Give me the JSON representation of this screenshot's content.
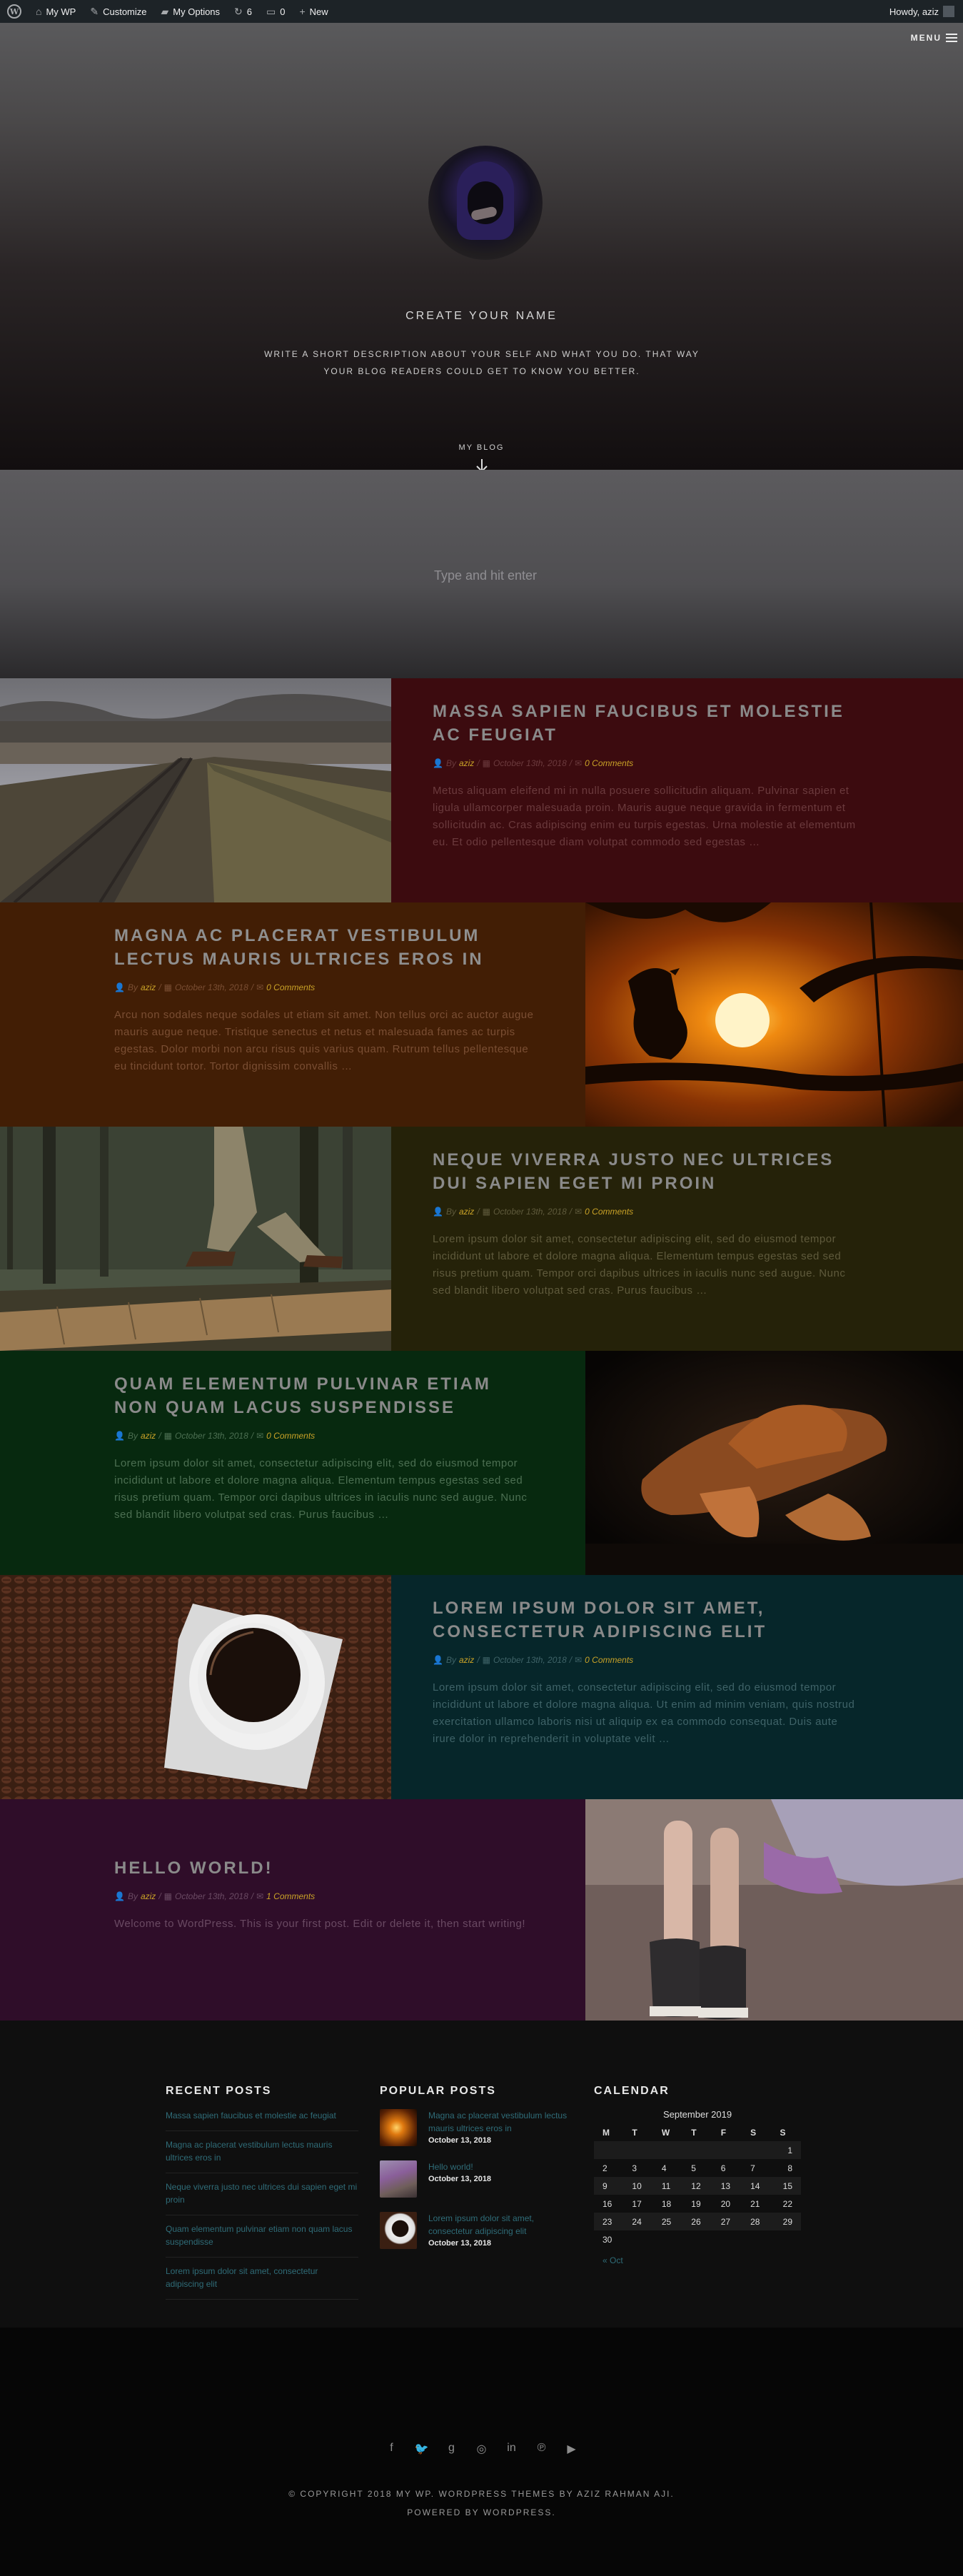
{
  "adminbar": {
    "site": "My WP",
    "customize": "Customize",
    "options": "My Options",
    "updates": "6",
    "comments": "0",
    "new": "New",
    "howdy": "Howdy, aziz"
  },
  "hero": {
    "menu": "MENU",
    "name": "CREATE YOUR NAME",
    "description": "WRITE A SHORT DESCRIPTION ABOUT YOUR SELF AND WHAT YOU DO. THAT WAY YOUR BLOG READERS COULD GET TO KNOW YOU BETTER.",
    "blog_link": "MY BLOG"
  },
  "search": {
    "placeholder": "Type and hit enter"
  },
  "posts": [
    {
      "title": "MASSA SAPIEN FAUCIBUS ET MOLESTIE AC FEUGIAT",
      "author": "aziz",
      "date": "October 13th, 2018",
      "comments": "0 Comments",
      "by": "By",
      "excerpt": "Metus aliquam eleifend mi in nulla posuere sollicitudin aliquam. Pulvinar sapien et ligula ullamcorper malesuada proin. Mauris augue neque gravida in fermentum et sollicitudin ac. Cras adipiscing enim eu turpis egestas. Urna molestie at elementum eu. Et odio pellentesque diam volutpat commodo sed egestas …",
      "bg": "#3c0b0f",
      "title_color": "#8a8a8a",
      "text_color": "#6b3a3d",
      "image": "railway"
    },
    {
      "title": "MAGNA AC PLACERAT VESTIBULUM LECTUS MAURIS ULTRICES EROS IN",
      "author": "aziz",
      "date": "October 13th, 2018",
      "comments": "0 Comments",
      "by": "By",
      "excerpt": "Arcu non sodales neque sodales ut etiam sit amet. Non tellus orci ac auctor augue mauris augue neque. Tristique senectus et netus et malesuada fames ac turpis egestas. Dolor morbi non arcu risus quis varius quam. Rutrum tellus pellentesque eu tincidunt tortor. Tortor dignissim convallis …",
      "bg": "#421e05",
      "title_color": "#8f8f8f",
      "text_color": "#7a4e33",
      "image": "sunset-bird"
    },
    {
      "title": "NEQUE VIVERRA JUSTO NEC ULTRICES DUI SAPIEN EGET MI PROIN",
      "author": "aziz",
      "date": "October 13th, 2018",
      "comments": "0 Comments",
      "by": "By",
      "excerpt": "Lorem ipsum dolor sit amet, consectetur adipiscing elit, sed do eiusmod tempor incididunt ut labore et dolore magna aliqua. Elementum tempus egestas sed sed risus pretium quam. Tempor orci dapibus ultrices in iaculis nunc sed augue. Nunc sed blandit libero volutpat sed cras. Purus faucibus …",
      "bg": "#252209",
      "title_color": "#8a8a8a",
      "text_color": "#5f5a3c",
      "image": "forest-walk"
    },
    {
      "title": "QUAM ELEMENTUM PULVINAR ETIAM NON QUAM LACUS SUSPENDISSE",
      "author": "aziz",
      "date": "October 13th, 2018",
      "comments": "0 Comments",
      "by": "By",
      "excerpt": "Lorem ipsum dolor sit amet, consectetur adipiscing elit, sed do eiusmod tempor incididunt ut labore et dolore magna aliqua. Elementum tempus egestas sed sed risus pretium quam. Tempor orci dapibus ultrices in iaculis nunc sed augue. Nunc sed blandit libero volutpat sed cras. Purus faucibus …",
      "bg": "#07290f",
      "title_color": "#8a8a8a",
      "text_color": "#4c6f52",
      "image": "cowboy-hat"
    },
    {
      "title": "LOREM IPSUM DOLOR SIT AMET, CONSECTETUR ADIPISCING ELIT",
      "author": "aziz",
      "date": "October 13th, 2018",
      "comments": "0 Comments",
      "by": "By",
      "excerpt": "Lorem ipsum dolor sit amet, consectetur adipiscing elit, sed do eiusmod tempor incididunt ut labore et dolore magna aliqua. Ut enim ad minim veniam, quis nostrud exercitation ullamco laboris nisi ut aliquip ex ea commodo consequat. Duis aute irure dolor in reprehenderit in voluptate velit …",
      "bg": "#06262a",
      "title_color": "#8a8a8a",
      "text_color": "#3f6368",
      "image": "coffee"
    },
    {
      "title": "HELLO WORLD!",
      "author": "aziz",
      "date": "October 13th, 2018",
      "comments": "1 Comments",
      "by": "By",
      "excerpt": "Welcome to WordPress. This is your first post. Edit or delete it, then start writing!",
      "bg": "#2f0d29",
      "title_color": "#8a8a8a",
      "text_color": "#6a4a63",
      "image": "sneakers"
    }
  ],
  "footer": {
    "recent_title": "RECENT POSTS",
    "recent": [
      "Massa sapien faucibus et molestie ac feugiat",
      "Magna ac placerat vestibulum lectus mauris ultrices eros in",
      "Neque viverra justo nec ultrices dui sapien eget mi proin",
      "Quam elementum pulvinar etiam non quam lacus suspendisse",
      "Lorem ipsum dolor sit amet, consectetur adipiscing elit"
    ],
    "popular_title": "POPULAR POSTS",
    "popular": [
      {
        "title": "Magna ac placerat vestibulum lectus mauris ultrices eros in",
        "date": "October 13, 2018",
        "thumb": "sunset"
      },
      {
        "title": "Hello world!",
        "date": "October 13, 2018",
        "thumb": "sneakers"
      },
      {
        "title": "Lorem ipsum dolor sit amet, consectetur adipiscing elit",
        "date": "October 13, 2018",
        "thumb": "coffee"
      }
    ],
    "calendar_title": "CALENDAR",
    "calendar": {
      "caption": "September 2019",
      "days": [
        "M",
        "T",
        "W",
        "T",
        "F",
        "S",
        "S"
      ],
      "weeks": [
        [
          "",
          "",
          "",
          "",
          "",
          "",
          "1"
        ],
        [
          "2",
          "3",
          "4",
          "5",
          "6",
          "7",
          "8"
        ],
        [
          "9",
          "10",
          "11",
          "12",
          "13",
          "14",
          "15"
        ],
        [
          "16",
          "17",
          "18",
          "19",
          "20",
          "21",
          "22"
        ],
        [
          "23",
          "24",
          "25",
          "26",
          "27",
          "28",
          "29"
        ],
        [
          "30",
          "",
          "",
          "",
          "",
          "",
          ""
        ]
      ],
      "prev": "« Oct"
    }
  },
  "bottom": {
    "socials": [
      "f",
      "t",
      "g",
      "ig",
      "in",
      "p",
      "yt"
    ],
    "copyright": "© COPYRIGHT 2018 MY WP.  WORDPRESS THEMES BY AZIZ RAHMAN AJI.",
    "powered": "POWERED BY WORDPRESS."
  }
}
